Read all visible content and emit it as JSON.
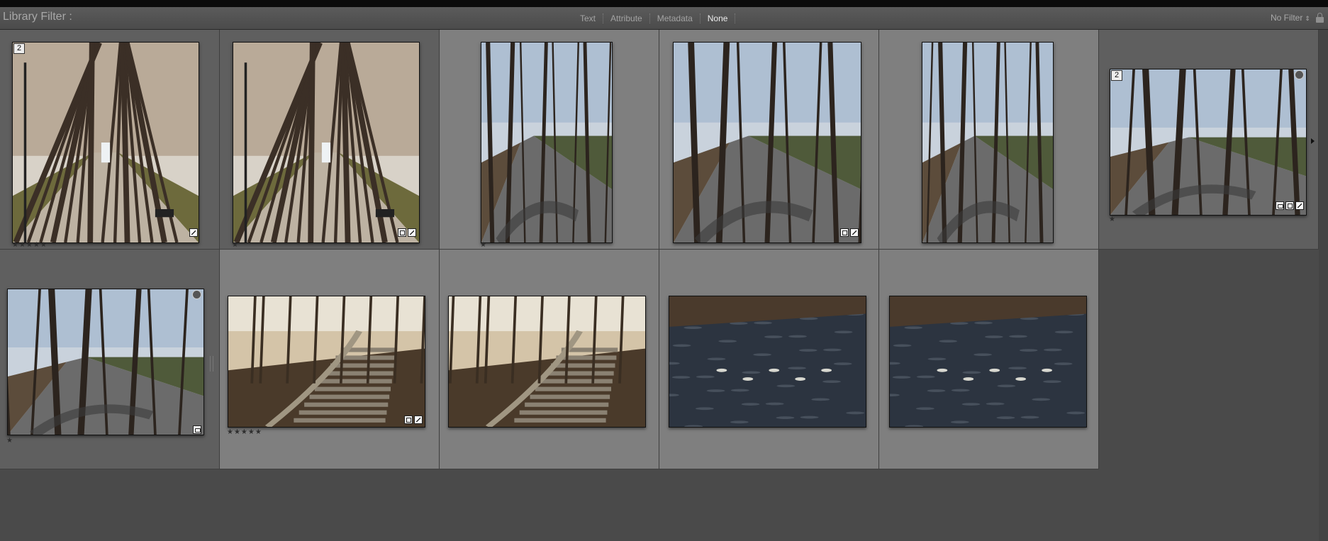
{
  "filter_bar": {
    "title": "Library Filter :",
    "tabs": [
      "Text",
      "Attribute",
      "Metadata",
      "None"
    ],
    "active_tab": "None",
    "preset": "No Filter",
    "lock_icon": "lock-icon"
  },
  "thumbnails": [
    {
      "id": "avenue-1",
      "scene": "tree-avenue",
      "stack_count": "2",
      "rating": "★★★★★",
      "badges": [
        "develop-icon"
      ]
    },
    {
      "id": "avenue-2",
      "scene": "tree-avenue",
      "rating": "★",
      "badges": [
        "crop-icon",
        "develop-icon"
      ]
    },
    {
      "id": "path-1",
      "scene": "forest-path",
      "rating": "★",
      "badges": []
    },
    {
      "id": "path-2",
      "scene": "forest-path",
      "rating": "",
      "badges": [
        "crop-icon",
        "develop-icon"
      ]
    },
    {
      "id": "path-3",
      "scene": "forest-path",
      "rating": "",
      "badges": []
    },
    {
      "id": "path-4",
      "scene": "forest-path",
      "stack_count": "2",
      "rating": "★",
      "badges": [
        "collection-icon",
        "crop-icon",
        "develop-icon"
      ],
      "circle": true
    },
    {
      "id": "path-5",
      "scene": "forest-path",
      "rating": "★",
      "badges": [
        "collection-icon"
      ],
      "circle": true
    },
    {
      "id": "stairs-1",
      "scene": "stone-stairs",
      "rating": "★★★★★",
      "badges": [
        "crop-icon",
        "develop-icon"
      ]
    },
    {
      "id": "stairs-2",
      "scene": "stone-stairs",
      "rating": "",
      "badges": []
    },
    {
      "id": "ducks-1",
      "scene": "duck-pond",
      "rating": "",
      "badges": []
    },
    {
      "id": "ducks-2",
      "scene": "duck-pond",
      "rating": "",
      "badges": []
    }
  ],
  "colors": {
    "selected_cell": "#7f7f7f",
    "primary_selected_cell": "#5f5f5f",
    "background": "#4a4a4a"
  }
}
